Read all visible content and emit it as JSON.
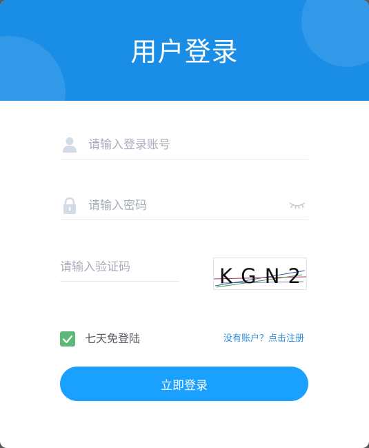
{
  "header": {
    "title": "用户登录"
  },
  "form": {
    "username": {
      "placeholder": "请输入登录账号",
      "value": "",
      "icon": "user-icon"
    },
    "password": {
      "placeholder": "请输入密码",
      "value": "",
      "icon": "lock-icon",
      "toggle_icon": "eye-closed-icon"
    },
    "captcha": {
      "placeholder": "请输入验证码",
      "value": "",
      "image_text": "KGN2"
    },
    "remember": {
      "label": "七天免登陆",
      "checked": true
    },
    "register_link": "没有账户？点击注册",
    "submit_label": "立即登录"
  },
  "colors": {
    "header": "#1a8ee6",
    "button": "#1aa0ff",
    "link": "#2f8fdd",
    "checkbox": "#5cb97a"
  }
}
